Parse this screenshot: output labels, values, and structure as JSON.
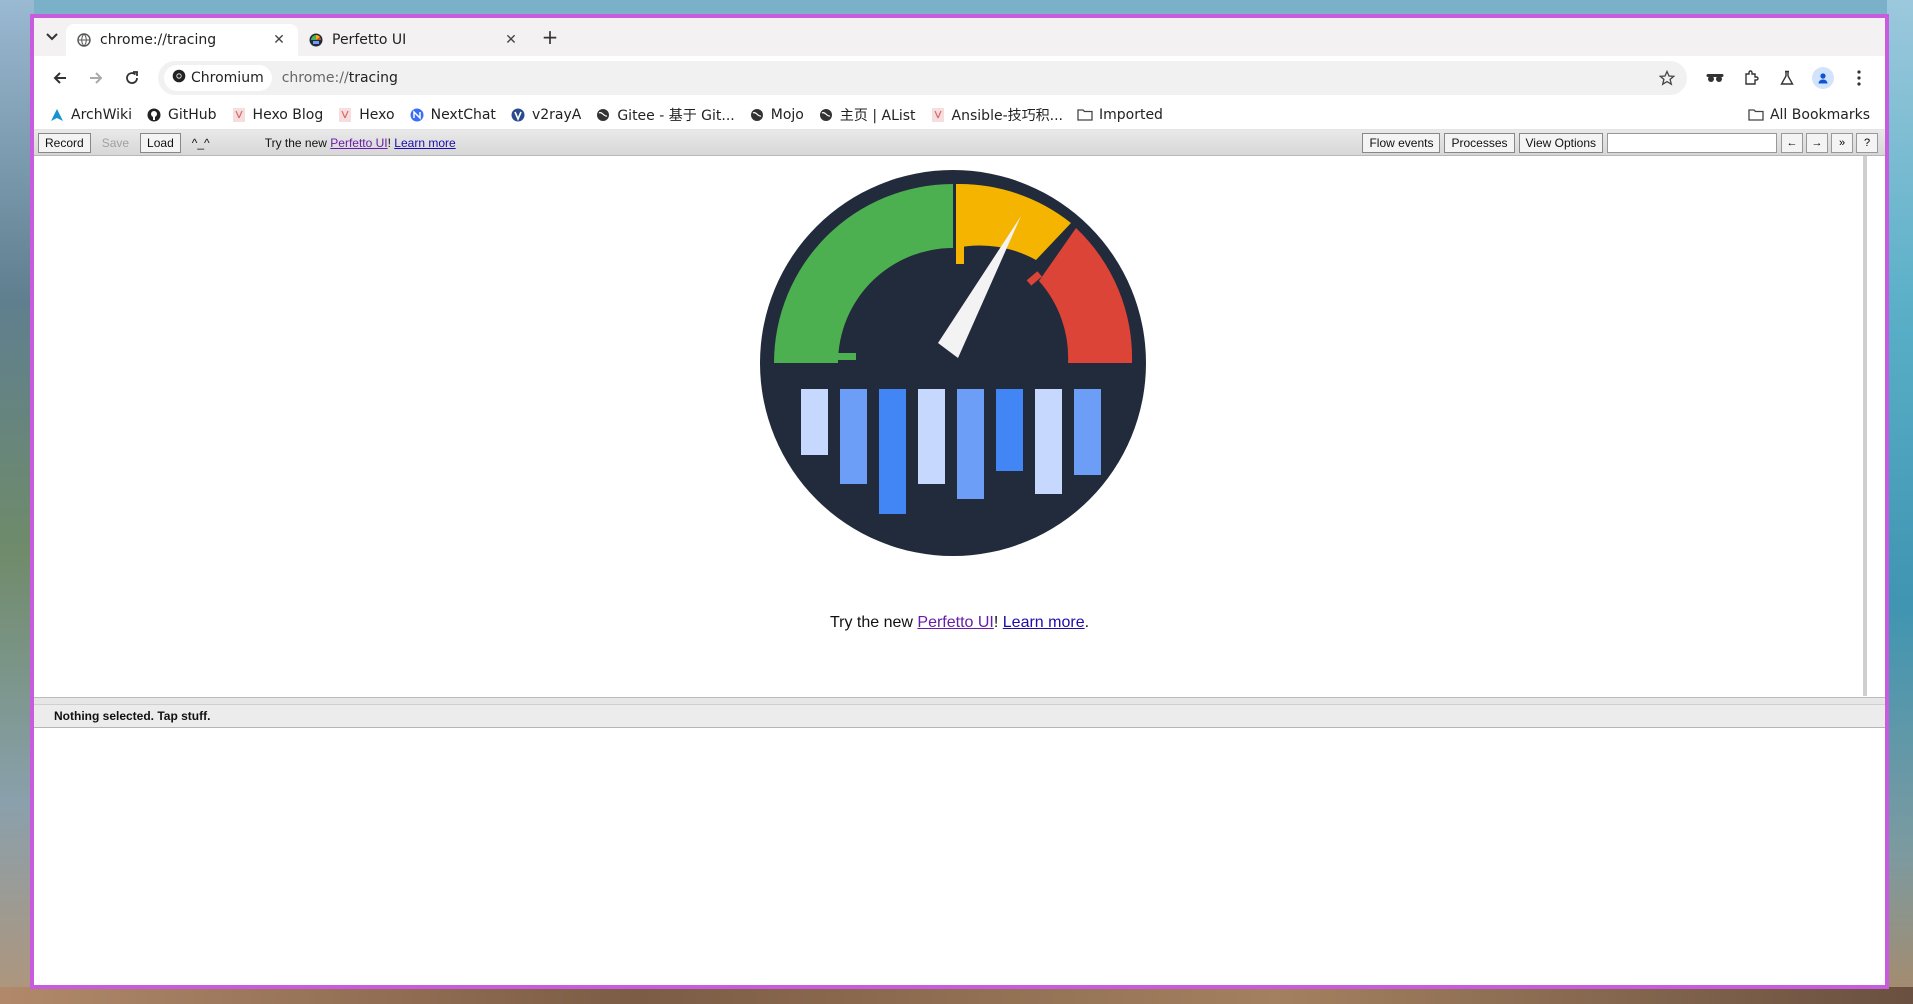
{
  "browser": {
    "tabs": [
      {
        "title": "chrome://tracing",
        "active": true,
        "icon": "globe-icon"
      },
      {
        "title": "Perfetto UI",
        "active": false,
        "icon": "perfetto-icon"
      }
    ],
    "new_tab_label": "+",
    "site_chip": "Chromium",
    "url_scheme": "chrome://",
    "url_path": "tracing"
  },
  "bookmarks": {
    "items": [
      {
        "label": "ArchWiki",
        "icon": "archwiki-icon"
      },
      {
        "label": "GitHub",
        "icon": "github-icon"
      },
      {
        "label": "Hexo Blog",
        "icon": "hexo-icon"
      },
      {
        "label": "Hexo",
        "icon": "hexo-icon"
      },
      {
        "label": "NextChat",
        "icon": "nextchat-icon"
      },
      {
        "label": "v2rayA",
        "icon": "v2raya-icon"
      },
      {
        "label": "Gitee - 基于 Git...",
        "icon": "globe-icon"
      },
      {
        "label": "Mojo",
        "icon": "globe-icon"
      },
      {
        "label": "主页 | AList",
        "icon": "globe-icon"
      },
      {
        "label": "Ansible-技巧积...",
        "icon": "hexo-icon"
      },
      {
        "label": "Imported",
        "icon": "folder-icon"
      }
    ],
    "all_bookmarks": "All Bookmarks"
  },
  "tracing": {
    "record": "Record",
    "save": "Save",
    "load": "Load",
    "emoticon": "^_^",
    "try_prefix": "Try the new ",
    "perfetto_link": "Perfetto UI",
    "exclaim": "! ",
    "learn_more": "Learn more",
    "period": ".",
    "flow_events": "Flow events",
    "processes": "Processes",
    "view_options": "View Options",
    "search_placeholder": "",
    "prev": "←",
    "next": "→",
    "expand": "»",
    "help": "?"
  },
  "logo_colors": {
    "background": "#222b3b",
    "green": "#4caf50",
    "yellow": "#f4b400",
    "red": "#db4437",
    "needle": "#f3f3f3",
    "bar_light": "#c6d8fd",
    "bar_mid": "#6c9ef8",
    "bar_dark": "#4285f4"
  },
  "analysis": {
    "status": "Nothing selected. Tap stuff."
  }
}
